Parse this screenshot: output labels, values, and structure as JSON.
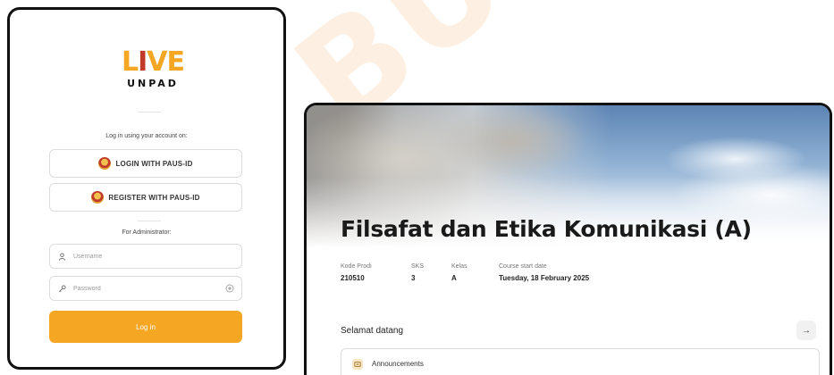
{
  "watermark": "BUIK",
  "login": {
    "logo": {
      "live_prefix": "L",
      "live_o": "I",
      "live_suffix": "VE",
      "unpad": "UNPAD"
    },
    "prompt": "Log in using your account on:",
    "sso_login_label": "LOGIN WITH PAUS-ID",
    "sso_register_label": "REGISTER WITH PAUS-ID",
    "admin_label": "For Administrator:",
    "username_placeholder": "Username",
    "password_placeholder": "Password",
    "submit_label": "Log in"
  },
  "course": {
    "title": "Filsafat dan Etika Komunikasi (A)",
    "meta": [
      {
        "label": "Kode Prodi",
        "value": "210510"
      },
      {
        "label": "SKS",
        "value": "3"
      },
      {
        "label": "Kelas",
        "value": "A"
      },
      {
        "label": "Course start date",
        "value": "Tuesday, 18 February 2025"
      }
    ],
    "welcome_label": "Selamat datang",
    "arrow": "→",
    "announcements_label": "Announcements"
  },
  "colors": {
    "brand_orange": "#f5a623",
    "brand_red": "#c0392b"
  },
  "icons": [
    "crest-icon",
    "user-icon",
    "key-icon",
    "eye-icon",
    "arrow-right-icon",
    "megaphone-icon"
  ]
}
